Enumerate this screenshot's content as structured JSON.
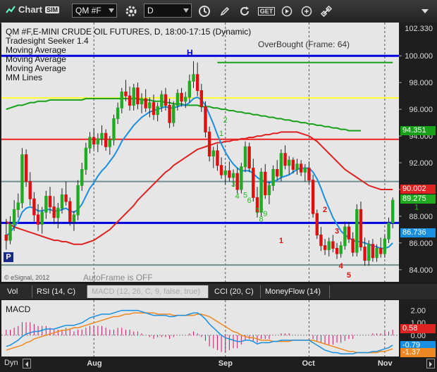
{
  "toolbar": {
    "app_title": "Chart",
    "sim_badge": "SIM",
    "symbol": "QM #F",
    "interval": "D",
    "get_label": "GET"
  },
  "legend": {
    "line1": "QM #F,E-MINI CRUDE OIL FUTURES, D, 18:00-17:15 (Dynamic)",
    "line2": "Tradesight Seeker 1.4",
    "line3": "Moving Average",
    "line4": "Moving Average",
    "line5": "Moving Average",
    "line6": "MM Lines"
  },
  "overbought": "OverBought (Frame: 64)",
  "autoframe": "AutoFrame is OFF",
  "copyright": "© eSignal, 2012",
  "p_marker": "P",
  "h_marker": "H",
  "tabs": [
    {
      "label": "Vol"
    },
    {
      "label": "RSI (14, C)"
    },
    {
      "label": "MACD (12, 26, C, 9, false, true)"
    },
    {
      "label": "CCI (20, C)"
    },
    {
      "label": "MoneyFlow (14)"
    }
  ],
  "macd_label": "MACD",
  "dyn_label": "Dyn",
  "colors": {
    "candle_up": "#22aa22",
    "candle_down": "#dd1111",
    "ma_blue": "#1a8fe0",
    "ma_red": "#dd2222",
    "ma_green": "#18a018",
    "mm_blue": "#0000dd",
    "mm_yellow": "#ffff33",
    "mm_red": "#ee2222",
    "mm_gray": "#6f8f8f"
  },
  "chart_data": {
    "type": "candlestick",
    "symbol": "QM #F",
    "interval": "D",
    "y_axis_ticks": [
      "100.000",
      "98.000",
      "96.000",
      "94.000",
      "92.000",
      "90.000",
      "88.000",
      "86.000",
      "84.000"
    ],
    "y_axis_top_label": "102.330",
    "ylim": [
      83.2,
      102.33
    ],
    "x_axis_labels": [
      "Aug",
      "Sep",
      "Oct",
      "Nov"
    ],
    "price_labels": [
      {
        "value": "94.351",
        "price": 94.351,
        "bg": "#18a018",
        "fg": "#ffffff"
      },
      {
        "value": "90.002",
        "price": 90.002,
        "bg": "#dd2222",
        "fg": "#ffffff"
      },
      {
        "value": "89.275",
        "price": 89.275,
        "bg": "#22aa22",
        "fg": "#ffffff"
      },
      {
        "value": "86.736",
        "price": 86.736,
        "bg": "#1a8fe0",
        "fg": "#ffffff"
      }
    ],
    "horizontal_lines": [
      {
        "name": "mm-blue-top",
        "price": 100.0,
        "color": "#0000dd"
      },
      {
        "name": "mm-yellow",
        "price": 96.85,
        "color": "#ffff33"
      },
      {
        "name": "mm-red",
        "price": 93.75,
        "color": "#ee2222"
      },
      {
        "name": "mm-gray-upper",
        "price": 90.6,
        "color": "#6f8f8f"
      },
      {
        "name": "mm-blue-mid",
        "price": 87.5,
        "color": "#0000dd"
      },
      {
        "name": "mm-gray-lower",
        "price": 84.35,
        "color": "#6f8f8f"
      }
    ],
    "green_target_line": {
      "price": 99.5,
      "from_index": 53,
      "to_index": 110
    },
    "candles": [
      [
        86.6,
        87.8,
        85.5,
        86.2
      ],
      [
        86.2,
        88.0,
        85.9,
        87.4
      ],
      [
        87.4,
        89.2,
        86.9,
        88.5
      ],
      [
        88.5,
        89.7,
        87.9,
        89.0
      ],
      [
        89.0,
        93.1,
        88.6,
        92.6
      ],
      [
        92.6,
        93.0,
        90.2,
        90.6
      ],
      [
        90.6,
        91.3,
        88.8,
        89.3
      ],
      [
        89.3,
        89.8,
        87.6,
        88.1
      ],
      [
        88.1,
        88.9,
        86.9,
        87.4
      ],
      [
        87.4,
        88.7,
        86.7,
        88.3
      ],
      [
        88.3,
        89.9,
        87.8,
        89.5
      ],
      [
        89.5,
        90.2,
        88.2,
        88.7
      ],
      [
        88.7,
        89.5,
        87.4,
        87.9
      ],
      [
        87.9,
        89.0,
        87.1,
        88.6
      ],
      [
        88.6,
        90.1,
        88.2,
        89.6
      ],
      [
        89.6,
        90.6,
        88.8,
        89.1
      ],
      [
        89.1,
        89.4,
        87.3,
        87.6
      ],
      [
        87.6,
        88.4,
        86.9,
        88.1
      ],
      [
        88.1,
        90.7,
        87.7,
        90.3
      ],
      [
        90.3,
        92.0,
        89.9,
        91.5
      ],
      [
        91.5,
        93.5,
        91.1,
        93.1
      ],
      [
        93.1,
        94.3,
        92.7,
        93.9
      ],
      [
        93.9,
        94.6,
        93.0,
        93.4
      ],
      [
        93.4,
        94.2,
        92.8,
        93.8
      ],
      [
        93.8,
        94.8,
        93.3,
        94.2
      ],
      [
        94.2,
        94.5,
        92.9,
        93.2
      ],
      [
        93.2,
        94.0,
        92.6,
        93.7
      ],
      [
        93.7,
        95.6,
        93.3,
        95.3
      ],
      [
        95.3,
        96.5,
        94.9,
        96.1
      ],
      [
        96.1,
        97.6,
        95.7,
        97.3
      ],
      [
        97.3,
        98.2,
        96.6,
        97.0
      ],
      [
        97.0,
        97.7,
        95.9,
        96.3
      ],
      [
        96.3,
        97.9,
        95.9,
        97.6
      ],
      [
        97.6,
        98.0,
        96.0,
        96.4
      ],
      [
        96.4,
        97.2,
        95.7,
        96.8
      ],
      [
        96.8,
        97.5,
        95.8,
        96.1
      ],
      [
        96.1,
        96.9,
        95.4,
        96.5
      ],
      [
        96.5,
        97.1,
        95.2,
        95.6
      ],
      [
        95.6,
        96.5,
        95.1,
        96.2
      ],
      [
        96.2,
        97.4,
        95.8,
        97.1
      ],
      [
        97.1,
        97.6,
        95.9,
        96.3
      ],
      [
        96.3,
        96.8,
        94.6,
        95.0
      ],
      [
        95.0,
        96.6,
        94.7,
        96.3
      ],
      [
        96.3,
        97.5,
        95.9,
        97.2
      ],
      [
        97.2,
        97.6,
        96.2,
        96.6
      ],
      [
        96.6,
        97.3,
        96.1,
        96.9
      ],
      [
        96.9,
        98.6,
        96.5,
        98.1
      ],
      [
        98.1,
        99.6,
        97.6,
        98.6
      ],
      [
        98.6,
        99.5,
        97.0,
        97.4
      ],
      [
        97.4,
        97.9,
        95.8,
        96.2
      ],
      [
        96.2,
        96.6,
        93.9,
        94.3
      ],
      [
        94.3,
        94.7,
        92.1,
        92.5
      ],
      [
        92.5,
        93.2,
        91.6,
        92.9
      ],
      [
        92.9,
        93.4,
        91.4,
        91.8
      ],
      [
        91.8,
        92.4,
        90.8,
        91.1
      ],
      [
        91.1,
        91.8,
        90.4,
        91.4
      ],
      [
        91.4,
        92.1,
        90.6,
        90.9
      ],
      [
        90.9,
        91.5,
        90.2,
        91.2
      ],
      [
        91.2,
        91.6,
        89.7,
        90.0
      ],
      [
        90.0,
        92.0,
        89.7,
        91.7
      ],
      [
        91.7,
        93.6,
        91.3,
        93.2
      ],
      [
        93.2,
        93.5,
        91.3,
        91.6
      ],
      [
        91.6,
        92.3,
        89.1,
        89.4
      ],
      [
        89.4,
        90.2,
        87.9,
        88.3
      ],
      [
        88.3,
        91.6,
        88.0,
        91.3
      ],
      [
        91.3,
        91.9,
        89.3,
        89.6
      ],
      [
        89.6,
        90.6,
        88.9,
        90.3
      ],
      [
        90.3,
        91.8,
        89.9,
        91.5
      ],
      [
        91.5,
        92.2,
        90.7,
        91.0
      ],
      [
        91.0,
        93.0,
        90.6,
        92.7
      ],
      [
        92.7,
        93.3,
        91.5,
        91.8
      ],
      [
        91.8,
        92.5,
        91.1,
        92.2
      ],
      [
        92.2,
        92.4,
        91.2,
        91.5
      ],
      [
        91.5,
        92.3,
        91.1,
        91.9
      ],
      [
        91.9,
        92.2,
        91.0,
        91.3
      ],
      [
        91.3,
        91.9,
        90.6,
        91.6
      ],
      [
        91.6,
        92.1,
        90.4,
        90.7
      ],
      [
        90.7,
        91.1,
        87.9,
        88.2
      ],
      [
        88.2,
        88.5,
        86.3,
        86.6
      ],
      [
        86.6,
        87.2,
        85.4,
        85.8
      ],
      [
        85.8,
        86.3,
        85.1,
        85.5
      ],
      [
        85.5,
        86.4,
        85.0,
        86.1
      ],
      [
        86.1,
        86.6,
        85.3,
        85.6
      ],
      [
        85.6,
        86.0,
        84.8,
        85.2
      ],
      [
        85.2,
        86.1,
        84.9,
        85.8
      ],
      [
        85.8,
        87.6,
        85.5,
        87.2
      ],
      [
        87.2,
        87.5,
        86.0,
        86.3
      ],
      [
        86.3,
        86.8,
        85.0,
        85.3
      ],
      [
        85.3,
        88.9,
        85.0,
        88.5
      ],
      [
        88.5,
        89.1,
        85.4,
        85.7
      ],
      [
        85.7,
        86.4,
        84.3,
        84.7
      ],
      [
        84.7,
        86.2,
        84.3,
        85.9
      ],
      [
        85.9,
        86.3,
        84.6,
        84.9
      ],
      [
        84.9,
        85.9,
        84.6,
        85.6
      ],
      [
        85.6,
        86.4,
        84.9,
        85.2
      ],
      [
        85.2,
        86.6,
        84.9,
        86.3
      ],
      [
        86.3,
        87.9,
        86.0,
        87.5
      ],
      [
        87.5,
        89.4,
        87.1,
        89.2
      ]
    ],
    "ma_blue": [
      86.5,
      86.8,
      87.2,
      87.6,
      88.3,
      88.6,
      88.7,
      88.6,
      88.4,
      88.4,
      88.5,
      88.5,
      88.4,
      88.4,
      88.5,
      88.6,
      88.4,
      88.3,
      88.5,
      88.9,
      89.5,
      90.1,
      90.5,
      91.0,
      91.4,
      91.7,
      92.1,
      92.5,
      93.0,
      93.6,
      94.0,
      94.4,
      94.8,
      95.1,
      95.4,
      95.6,
      95.8,
      95.9,
      96.0,
      96.1,
      96.2,
      96.1,
      96.1,
      96.2,
      96.3,
      96.3,
      96.5,
      96.8,
      96.9,
      96.7,
      96.3,
      95.6,
      94.9,
      94.1,
      93.4,
      92.8,
      92.3,
      91.9,
      91.6,
      91.4,
      91.4,
      91.4,
      91.2,
      90.9,
      90.7,
      90.6,
      90.5,
      90.6,
      90.7,
      90.9,
      91.0,
      91.1,
      91.3,
      91.5,
      91.6,
      91.6,
      91.6,
      91.3,
      90.8,
      90.1,
      89.3,
      88.6,
      87.9,
      87.4,
      86.9,
      86.6,
      86.4,
      86.2,
      86.1,
      86.1,
      86.0,
      85.9,
      85.8,
      85.7,
      85.6,
      85.6,
      85.7,
      86.0
    ],
    "ma_red": [
      87.6,
      87.4,
      87.2,
      87.1,
      87.0,
      86.9,
      86.8,
      86.7,
      86.6,
      86.5,
      86.4,
      86.3,
      86.2,
      86.2,
      86.1,
      86.1,
      86.0,
      85.9,
      85.9,
      85.9,
      86.0,
      86.1,
      86.2,
      86.4,
      86.6,
      86.8,
      87.0,
      87.3,
      87.6,
      87.9,
      88.2,
      88.5,
      88.8,
      89.2,
      89.5,
      89.8,
      90.1,
      90.4,
      90.7,
      91.0,
      91.3,
      91.5,
      91.8,
      92.0,
      92.2,
      92.4,
      92.6,
      92.8,
      93.0,
      93.1,
      93.2,
      93.3,
      93.4,
      93.5,
      93.5,
      93.6,
      93.6,
      93.7,
      93.7,
      93.8,
      93.8,
      93.9,
      93.9,
      94.0,
      94.0,
      94.1,
      94.1,
      94.2,
      94.2,
      94.3,
      94.3,
      94.3,
      94.3,
      94.3,
      94.2,
      94.1,
      94.0,
      93.8,
      93.6,
      93.3,
      93.0,
      92.7,
      92.4,
      92.1,
      91.8,
      91.5,
      91.3,
      91.1,
      90.9,
      90.7,
      90.5,
      90.3,
      90.2,
      90.1,
      90.0,
      90.0,
      90.0,
      90.0
    ],
    "ma_green": [
      96.0,
      96.1,
      96.2,
      96.3,
      96.3,
      96.4,
      96.5,
      96.5,
      96.6,
      96.6,
      96.6,
      96.7,
      96.7,
      96.7,
      96.7,
      96.7,
      96.7,
      96.7,
      96.7,
      96.7,
      96.8,
      96.8,
      96.8,
      96.8,
      96.8,
      96.8,
      96.8,
      96.8,
      96.8,
      96.8,
      96.8,
      96.8,
      96.8,
      96.8,
      96.7,
      96.7,
      96.7,
      96.6,
      96.6,
      96.6,
      96.5,
      96.5,
      96.4,
      96.4,
      96.4,
      96.3,
      96.3,
      96.3,
      96.3,
      96.2,
      96.2,
      96.2,
      96.1,
      96.1,
      96.0,
      96.0,
      95.9,
      95.9,
      95.8,
      95.8,
      95.7,
      95.7,
      95.6,
      95.6,
      95.5,
      95.5,
      95.4,
      95.4,
      95.3,
      95.3,
      95.2,
      95.2,
      95.1,
      95.1,
      95.0,
      95.0,
      94.9,
      94.9,
      94.8,
      94.8,
      94.7,
      94.7,
      94.6,
      94.6,
      94.5,
      94.5,
      94.4,
      94.4,
      94.4,
      94.4
    ],
    "green_count": [
      {
        "label": "1",
        "index": 54,
        "price": 94.0
      },
      {
        "label": "2",
        "index": 55,
        "price": 95.0
      },
      {
        "label": "3",
        "index": 57,
        "price": 90.2
      },
      {
        "label": "4",
        "index": 58,
        "price": 89.3
      },
      {
        "label": "5",
        "index": 60,
        "price": 89.4
      },
      {
        "label": "6",
        "index": 61,
        "price": 89.0
      },
      {
        "label": "7",
        "index": 63,
        "price": 88.2
      },
      {
        "label": "9",
        "index": 65,
        "price": 88.0
      },
      {
        "label": "8",
        "index": 64,
        "price": 87.6
      },
      {
        "label": "1",
        "index": 103,
        "price": 88.5
      }
    ],
    "red_count": [
      {
        "label": "1",
        "index": 69,
        "price": 86.0
      },
      {
        "label": "2",
        "index": 80,
        "price": 88.3
      },
      {
        "label": "3",
        "index": 83,
        "price": 86.7
      },
      {
        "label": "4",
        "index": 84,
        "price": 84.1
      },
      {
        "label": "5",
        "index": 86,
        "price": 83.4
      }
    ],
    "macd": {
      "ylim": [
        -1.6,
        2.6
      ],
      "y_axis_ticks": [
        "2.00",
        "1.00",
        "0.00"
      ],
      "labels": [
        {
          "value": "0.58",
          "v": 0.58,
          "bg": "#dd2222"
        },
        {
          "value": "-0.79",
          "v": -0.79,
          "bg": "#1a8fe0"
        },
        {
          "value": "-1.37",
          "v": -1.37,
          "bg": "#ee8822"
        }
      ],
      "macd_line": [
        -0.9,
        -0.8,
        -0.6,
        -0.4,
        -0.1,
        0.1,
        0.2,
        0.3,
        0.3,
        0.4,
        0.5,
        0.5,
        0.5,
        0.6,
        0.7,
        0.8,
        0.8,
        0.8,
        0.9,
        1.0,
        1.2,
        1.4,
        1.5,
        1.6,
        1.7,
        1.7,
        1.7,
        1.8,
        1.9,
        2.0,
        2.0,
        2.0,
        2.0,
        2.0,
        1.9,
        1.8,
        1.7,
        1.6,
        1.6,
        1.6,
        1.6,
        1.5,
        1.5,
        1.6,
        1.6,
        1.6,
        1.7,
        1.8,
        1.8,
        1.6,
        1.3,
        0.9,
        0.6,
        0.3,
        0.0,
        -0.2,
        -0.3,
        -0.4,
        -0.5,
        -0.5,
        -0.4,
        -0.4,
        -0.5,
        -0.7,
        -0.6,
        -0.6,
        -0.6,
        -0.5,
        -0.5,
        -0.4,
        -0.4,
        -0.4,
        -0.4,
        -0.4,
        -0.4,
        -0.4,
        -0.4,
        -0.6,
        -0.8,
        -1.0,
        -1.2,
        -1.3,
        -1.4,
        -1.4,
        -1.5,
        -1.5,
        -1.5,
        -1.5,
        -1.4,
        -1.4,
        -1.4,
        -1.4,
        -1.3,
        -1.3,
        -1.2,
        -1.1,
        -1.0,
        -0.8
      ],
      "signal_line": [
        -1.2,
        -1.1,
        -1.0,
        -0.9,
        -0.8,
        -0.6,
        -0.5,
        -0.3,
        -0.2,
        -0.1,
        0.0,
        0.1,
        0.2,
        0.3,
        0.4,
        0.4,
        0.5,
        0.6,
        0.6,
        0.7,
        0.8,
        0.9,
        1.0,
        1.1,
        1.2,
        1.3,
        1.4,
        1.5,
        1.5,
        1.6,
        1.7,
        1.7,
        1.8,
        1.8,
        1.8,
        1.8,
        1.8,
        1.8,
        1.7,
        1.7,
        1.7,
        1.7,
        1.6,
        1.6,
        1.6,
        1.6,
        1.6,
        1.6,
        1.7,
        1.7,
        1.6,
        1.5,
        1.3,
        1.1,
        0.9,
        0.7,
        0.5,
        0.3,
        0.2,
        0.0,
        -0.1,
        -0.2,
        -0.2,
        -0.3,
        -0.4,
        -0.4,
        -0.4,
        -0.5,
        -0.5,
        -0.5,
        -0.5,
        -0.5,
        -0.4,
        -0.4,
        -0.4,
        -0.4,
        -0.4,
        -0.4,
        -0.5,
        -0.6,
        -0.7,
        -0.8,
        -0.9,
        -1.0,
        -1.1,
        -1.2,
        -1.3,
        -1.3,
        -1.4,
        -1.4,
        -1.4,
        -1.4,
        -1.4,
        -1.4,
        -1.3,
        -1.3,
        -1.2,
        -1.1
      ]
    }
  }
}
